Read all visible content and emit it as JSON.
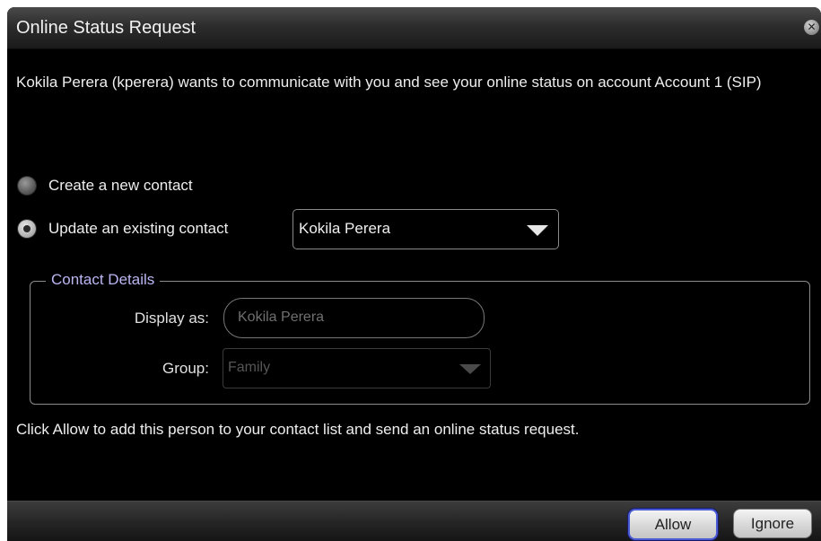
{
  "window": {
    "title": "Online Status Request"
  },
  "message": "Kokila Perera (kperera) wants to communicate with you and see your online status on account Account 1 (SIP)",
  "options": {
    "create_label": "Create a new contact",
    "update_label": "Update an existing contact",
    "selected": "update",
    "contact_select_value": "Kokila Perera"
  },
  "contact_details": {
    "legend": "Contact Details",
    "display_as_label": "Display as:",
    "display_as_placeholder": "Kokila Perera",
    "group_label": "Group:",
    "group_value": "Family"
  },
  "footer_message": "Click Allow to add this person to your contact list and send an online status request.",
  "buttons": {
    "allow": "Allow",
    "ignore": "Ignore"
  },
  "colors": {
    "background": "#000000",
    "legend_text": "#b9b6f2",
    "default_button_border": "#4a5cd4"
  }
}
